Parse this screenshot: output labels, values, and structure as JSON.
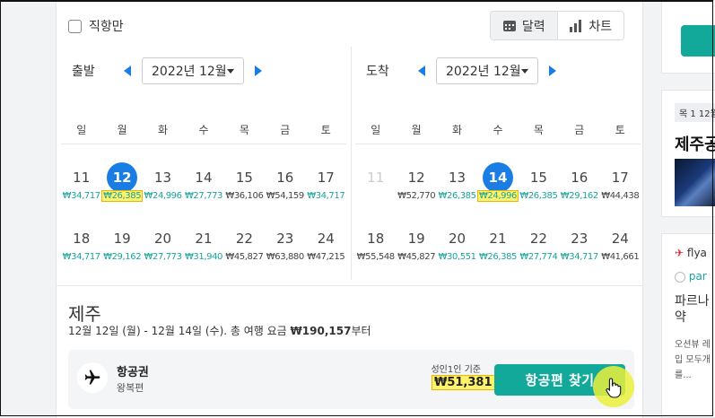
{
  "filters": {
    "direct_only_label": "직항만"
  },
  "view_toggle": {
    "calendar_label": "달력",
    "chart_label": "차트"
  },
  "departure": {
    "label": "출발",
    "month": "2022년 12월",
    "weekdays": [
      "일",
      "월",
      "화",
      "수",
      "목",
      "금",
      "토"
    ],
    "weeks": [
      [
        {
          "day": "11",
          "price": "₩34,717"
        },
        {
          "day": "12",
          "price": "₩26,385",
          "selected": true,
          "highlight": true
        },
        {
          "day": "13",
          "price": "₩24,996"
        },
        {
          "day": "14",
          "price": "₩27,773"
        },
        {
          "day": "15",
          "price": "₩36,106",
          "dark": true
        },
        {
          "day": "16",
          "price": "₩54,159",
          "dark": true
        },
        {
          "day": "17",
          "price": "₩34,717"
        }
      ],
      [
        {
          "day": "18",
          "price": "₩34,717"
        },
        {
          "day": "19",
          "price": "₩29,162"
        },
        {
          "day": "20",
          "price": "₩27,773"
        },
        {
          "day": "21",
          "price": "₩31,940"
        },
        {
          "day": "22",
          "price": "₩45,827",
          "dark": true
        },
        {
          "day": "23",
          "price": "₩63,880",
          "dark": true
        },
        {
          "day": "24",
          "price": "₩47,215",
          "dark": true
        }
      ]
    ]
  },
  "arrival": {
    "label": "도착",
    "month": "2022년 12월",
    "weekdays": [
      "일",
      "월",
      "화",
      "수",
      "목",
      "금",
      "토"
    ],
    "weeks": [
      [
        {
          "day": "11",
          "price": "",
          "dim": true
        },
        {
          "day": "12",
          "price": "₩52,770",
          "dark": true
        },
        {
          "day": "13",
          "price": "₩26,385"
        },
        {
          "day": "14",
          "price": "₩24,996",
          "selected": true,
          "highlight": true
        },
        {
          "day": "15",
          "price": "₩26,385"
        },
        {
          "day": "16",
          "price": "₩29,162"
        },
        {
          "day": "17",
          "price": "₩44,438",
          "dark": true
        }
      ],
      [
        {
          "day": "18",
          "price": "₩55,548",
          "dark": true
        },
        {
          "day": "19",
          "price": "₩45,827",
          "dark": true
        },
        {
          "day": "20",
          "price": "₩30,551"
        },
        {
          "day": "21",
          "price": "₩26,385"
        },
        {
          "day": "22",
          "price": "₩27,774"
        },
        {
          "day": "23",
          "price": "₩34,717"
        },
        {
          "day": "24",
          "price": "₩41,661",
          "dark": true
        }
      ]
    ]
  },
  "trip": {
    "destination": "제주",
    "dates": "12월 12일 (월) - 12월 14일 (수). 총 여행 요금 ",
    "total_fare": "₩190,157",
    "total_suffix": "부터"
  },
  "result_card": {
    "title": "항공권",
    "subtitle": "왕복편",
    "basis": "성인1인 기준",
    "price": "₩51,381",
    "button_label": "항공편 찾기"
  },
  "sidebar": {
    "tag": "목 1 12월",
    "title": "제주공",
    "brand": "flya",
    "partner": "par",
    "headline1": "파르나",
    "headline2": "약",
    "desc1": "오션뷰 레",
    "desc2": "입 모두개",
    "desc3": "를..."
  },
  "colors": {
    "accent": "#1a7de3",
    "brand": "#12a99a",
    "price": "#1ba39c",
    "highlight": "#fff36b"
  }
}
